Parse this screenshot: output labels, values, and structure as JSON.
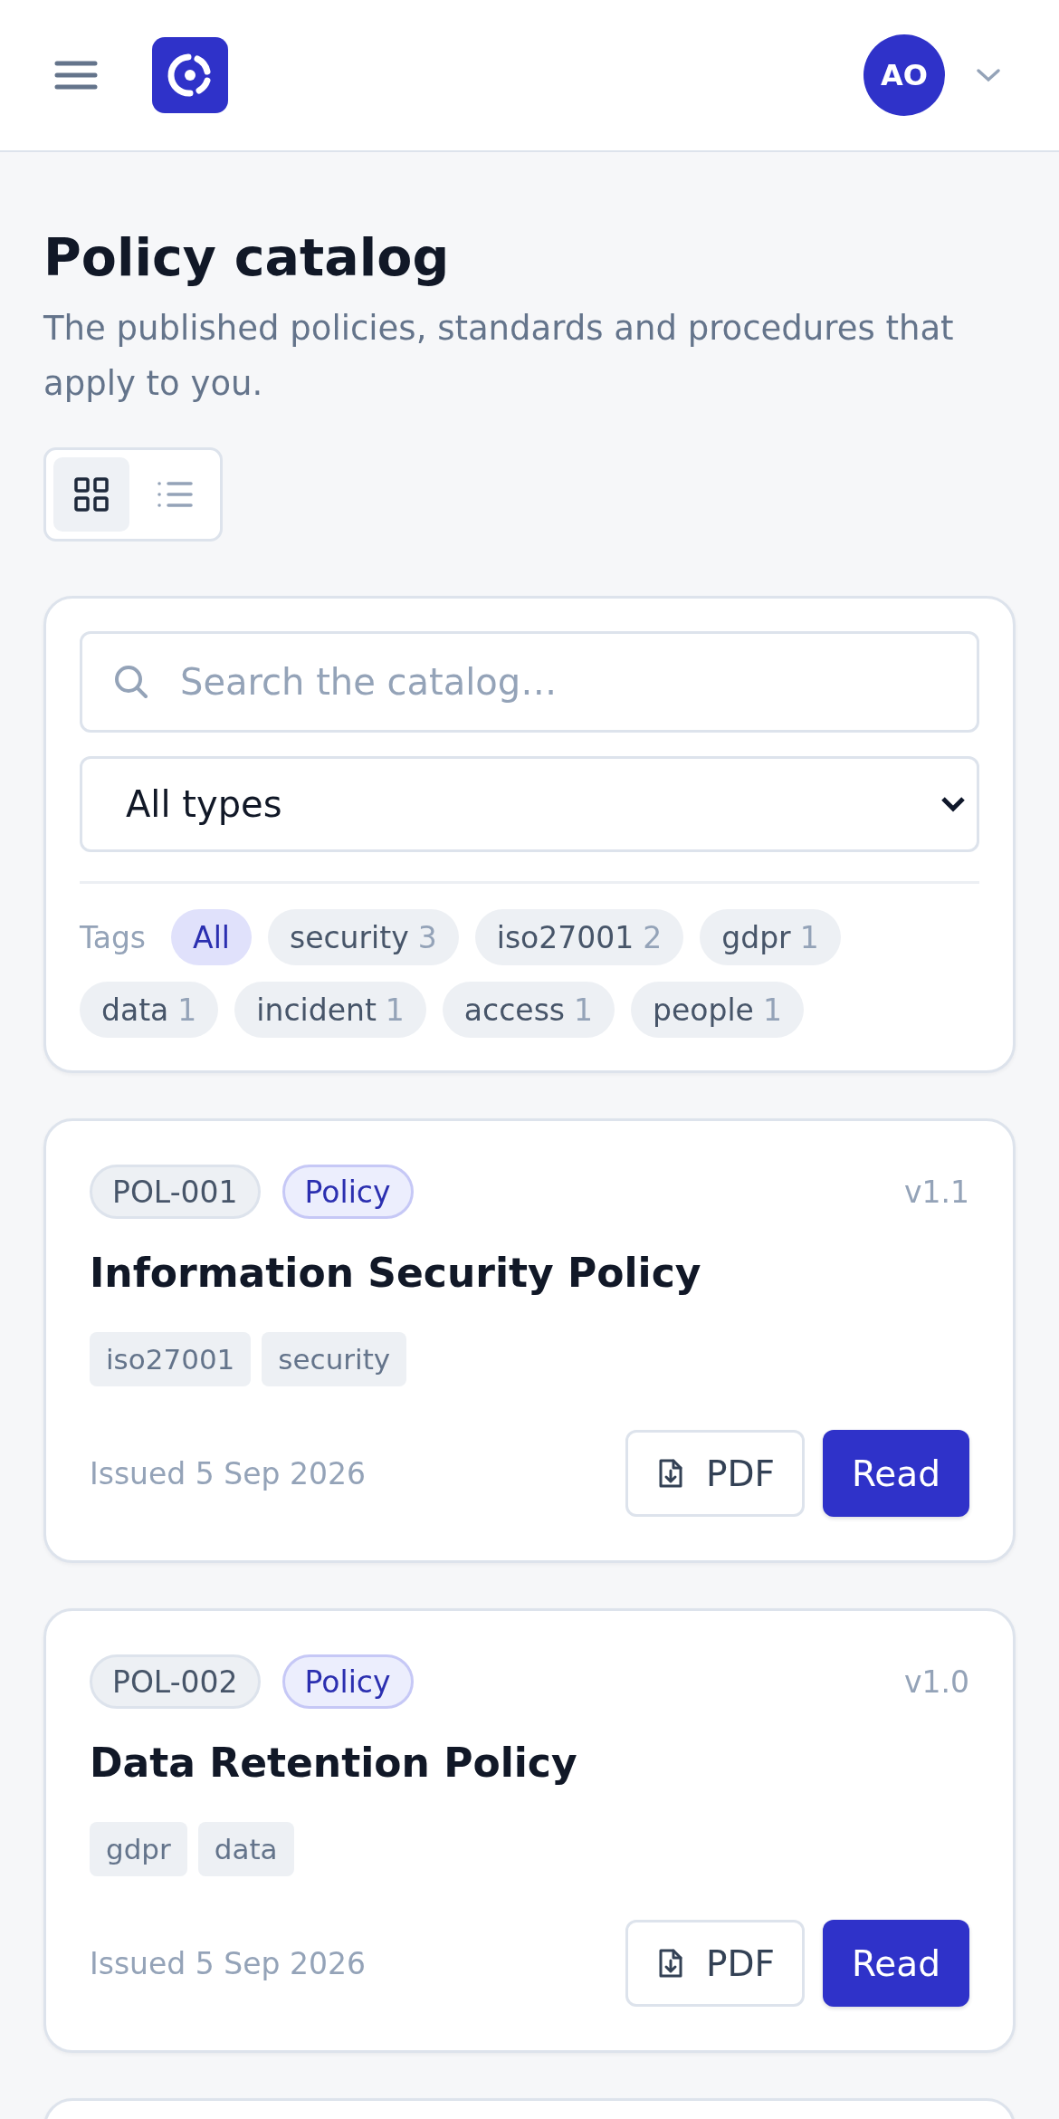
{
  "header": {
    "avatar": {
      "initials": "AO"
    }
  },
  "page": {
    "title": "Policy catalog",
    "subtitle": "The published policies, standards and procedures that apply to you."
  },
  "view_toggle": [
    {
      "kind": "grid",
      "selected": true
    },
    {
      "kind": "list",
      "selected": false
    }
  ],
  "filters": {
    "search": {
      "placeholder": "Search the catalog…"
    },
    "type_select": {
      "value": "All types"
    },
    "tags_label": "Tags",
    "tags": [
      {
        "label": "All",
        "selected": true
      },
      {
        "label": "security",
        "count": "3",
        "selected": false
      },
      {
        "label": "iso27001",
        "count": "2",
        "selected": false
      },
      {
        "label": "gdpr",
        "count": "1",
        "selected": false
      },
      {
        "label": "data",
        "count": "1",
        "selected": false
      },
      {
        "label": "incident",
        "count": "1",
        "selected": false
      },
      {
        "label": "access",
        "count": "1",
        "selected": false
      },
      {
        "label": "people",
        "count": "1",
        "selected": false
      }
    ]
  },
  "documents": [
    {
      "id": "POL-001",
      "type": "Policy",
      "version": "v1.1",
      "title": "Information Security Policy",
      "tags": [
        "iso27001",
        "security"
      ],
      "issued": "Issued 5 Sep 2026",
      "pdf_label": "PDF",
      "read_label": "Read"
    },
    {
      "id": "POL-002",
      "type": "Policy",
      "version": "v1.0",
      "title": "Data Retention Policy",
      "tags": [
        "gdpr",
        "data"
      ],
      "issued": "Issued 5 Sep 2026",
      "pdf_label": "PDF",
      "read_label": "Read"
    }
  ]
}
